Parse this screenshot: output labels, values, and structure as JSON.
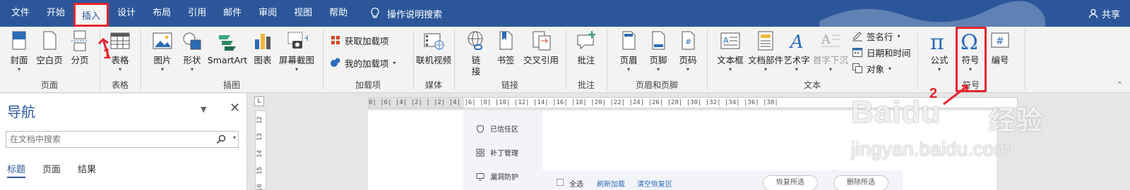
{
  "menubar": {
    "tabs": [
      "文件",
      "开始",
      "插入",
      "设计",
      "布局",
      "引用",
      "邮件",
      "审阅",
      "视图",
      "帮助"
    ],
    "active_tab": "插入",
    "tellme": "操作说明搜索",
    "share": "共享"
  },
  "ribbon": {
    "pages": {
      "cover": "封面",
      "blank": "空白页",
      "break": "分页",
      "group": "页面"
    },
    "table": {
      "table": "表格",
      "group": "表格"
    },
    "illus": {
      "picture": "图片",
      "shape": "形状",
      "smartart": "SmartArt",
      "chart": "图表",
      "screenshot": "屏幕截图",
      "group": "插图"
    },
    "addins": {
      "get": "获取加载项",
      "my": "我的加载项",
      "group": "加载项"
    },
    "media": {
      "video": "联机视频",
      "group": "媒体"
    },
    "links": {
      "link_1": "链",
      "link_2": "接",
      "bookmark": "书签",
      "xref": "交叉引用",
      "group": "链接"
    },
    "comments": {
      "comment": "批注",
      "group": "批注"
    },
    "hf": {
      "header": "页眉",
      "footer": "页脚",
      "pagenum": "页码",
      "group": "页眉和页脚"
    },
    "text": {
      "textbox": "文本框",
      "parts": "文档部件",
      "wordart": "艺术字",
      "dropcap": "首字下沉",
      "sigline": "签名行",
      "datetime": "日期和时间",
      "object": "对象",
      "group": "文本"
    },
    "symbols": {
      "equation": "公式",
      "symbol": "符号",
      "number": "编号",
      "group": "符号"
    }
  },
  "nav": {
    "title": "导航",
    "search_placeholder": "在文档中搜索",
    "tabs": [
      "标题",
      "页面",
      "结果"
    ]
  },
  "ruler": {
    "horizontal": "8| |6| |4| |2| |  |2| |4| |6| |8| |10| |12| |14| |16| |18| |20| |22| |24| |26| |28| |30| |32| |34| |36| |38|",
    "vertical": [
      "12",
      "13",
      "14",
      "15",
      "16"
    ]
  },
  "embedded": {
    "side_items": [
      "已信任区",
      "补丁管理",
      "漏洞防护"
    ],
    "bar": {
      "select_all": "全选",
      "refresh": "刷新加载",
      "clear": "清空恢复区",
      "restore": "恢复所选",
      "delete": "删除所选"
    }
  },
  "annotations": {
    "step1": "1",
    "step2": "2"
  },
  "watermark": {
    "brand": "Baidu",
    "brand_cn": "经验",
    "url": "jingyan.baidu.com"
  },
  "colors": {
    "titlebar": "#2b579a",
    "highlight": "#e3262f",
    "ribbon": "#f3f3f3"
  }
}
